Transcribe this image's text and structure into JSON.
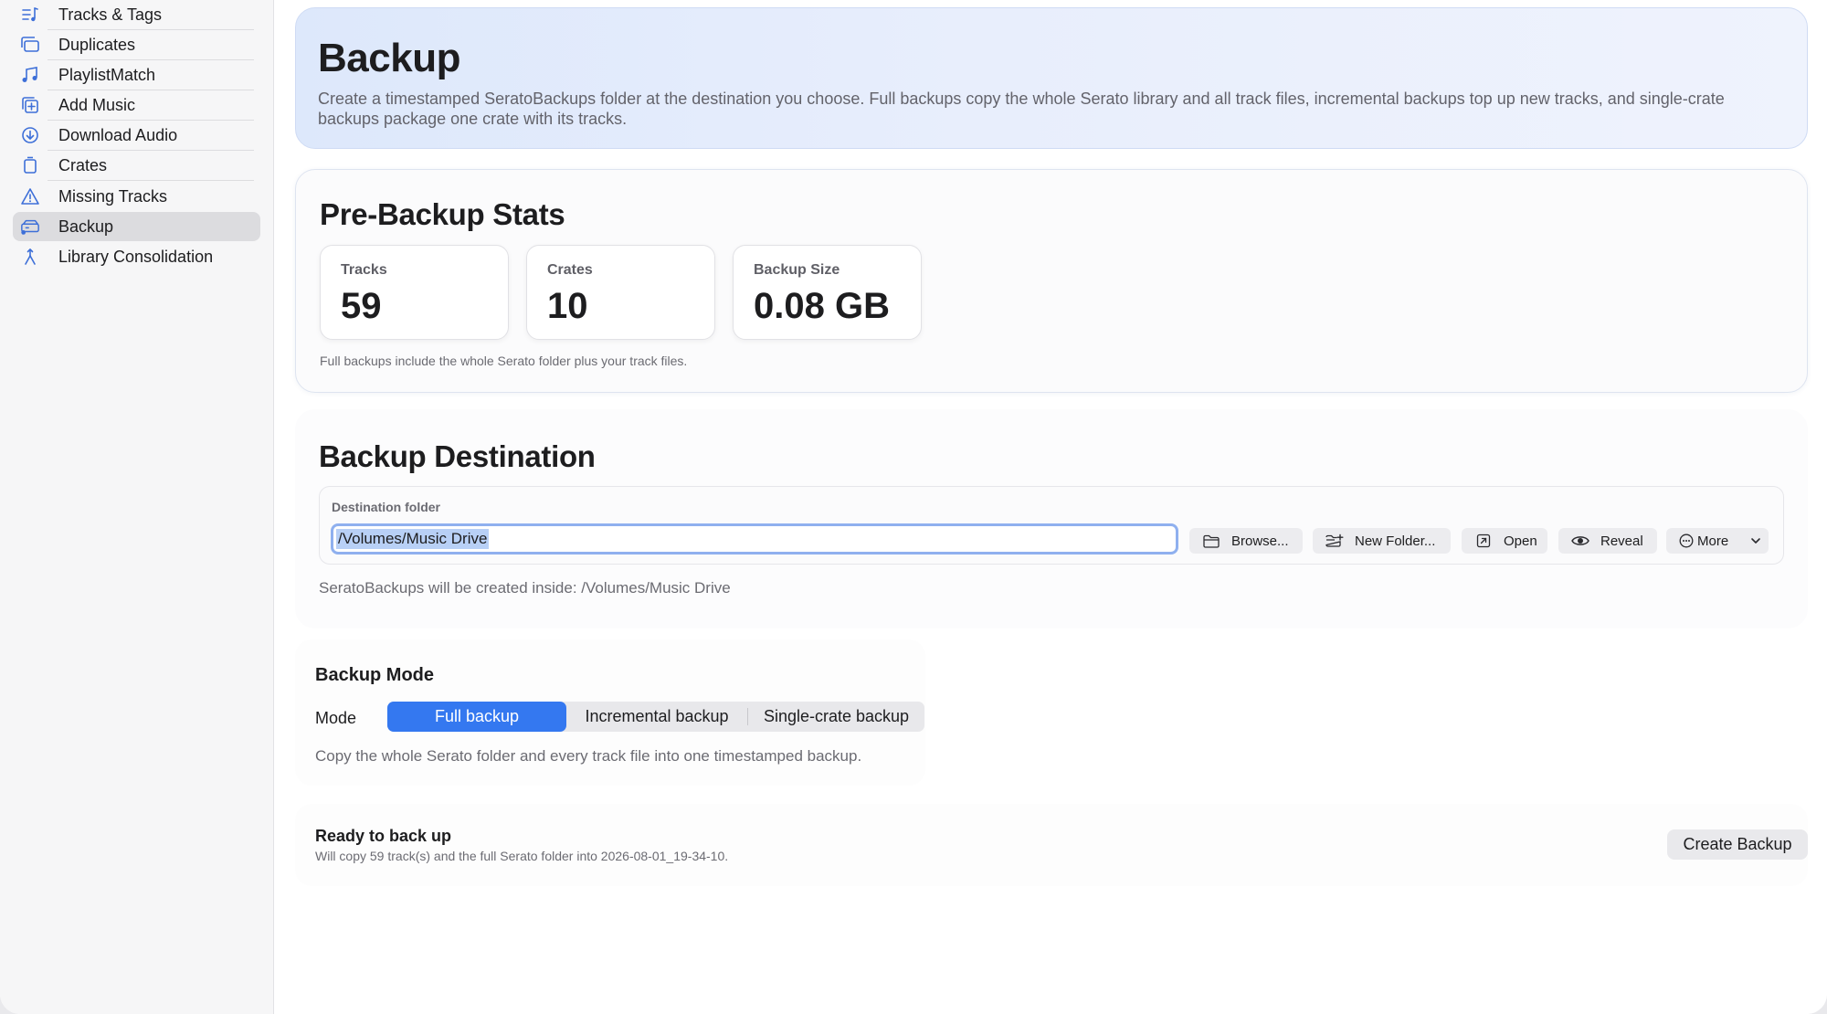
{
  "sidebar": {
    "items": [
      {
        "label": "Tracks & Tags",
        "icon": "music-list-icon"
      },
      {
        "label": "Duplicates",
        "icon": "duplicate-icon"
      },
      {
        "label": "PlaylistMatch",
        "icon": "music-note-icon"
      },
      {
        "label": "Add Music",
        "icon": "add-square-icon"
      },
      {
        "label": "Download Audio",
        "icon": "download-circle-icon"
      },
      {
        "label": "Crates",
        "icon": "crate-icon"
      },
      {
        "label": "Missing Tracks",
        "icon": "warning-icon"
      },
      {
        "label": "Backup",
        "icon": "backup-drive-icon",
        "active": true
      },
      {
        "label": "Library Consolidation",
        "icon": "merge-icon"
      }
    ]
  },
  "header": {
    "title": "Backup",
    "description": "Create a timestamped SeratoBackups folder at the destination you choose. Full backups copy the whole Serato library and all track files, incremental backups top up new tracks, and single-crate backups package one crate with its tracks."
  },
  "stats": {
    "title": "Pre-Backup Stats",
    "tracks_label": "Tracks",
    "tracks_value": "59",
    "crates_label": "Crates",
    "crates_value": "10",
    "size_label": "Backup Size",
    "size_value": "0.08 GB",
    "note": "Full backups include the whole Serato folder plus your track files."
  },
  "destination": {
    "title": "Backup Destination",
    "field_label": "Destination folder",
    "value": "/Volumes/Music Drive",
    "browse": "Browse...",
    "new_folder": "New Folder...",
    "open": "Open",
    "reveal": "Reveal",
    "more": "More",
    "note": "SeratoBackups will be created inside: /Volumes/Music Drive"
  },
  "mode": {
    "title": "Backup Mode",
    "label": "Mode",
    "options": [
      "Full backup",
      "Incremental backup",
      "Single-crate backup"
    ],
    "selected": "Full backup",
    "note": "Copy the whole Serato folder and every track file into one timestamped backup."
  },
  "ready": {
    "title": "Ready to back up",
    "note": "Will copy 59 track(s) and the full Serato folder into 2026-08-01_19-34-10.",
    "button": "Create Backup"
  },
  "colors": {
    "accent": "#3478f0",
    "sidebar_icon": "#3d6fd8",
    "selection": "#b8d0f6"
  }
}
